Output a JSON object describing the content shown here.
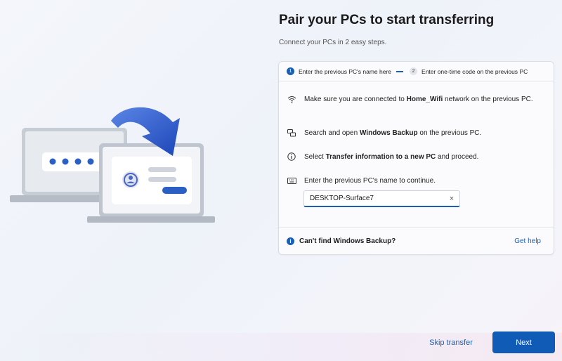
{
  "header": {
    "title": "Pair your PCs to start transferring",
    "subtitle": "Connect your PCs in 2 easy steps."
  },
  "steps": [
    {
      "number": "1",
      "label": "Enter the previous PC's name here",
      "state": "active"
    },
    {
      "number": "2",
      "label": "Enter one-time code on the previous PC",
      "state": "inactive"
    }
  ],
  "instructions": {
    "wifi": {
      "icon": "wifi-icon",
      "pre": "Make sure you are connected to ",
      "bold": "Home_Wifi",
      "post": " network on the previous PC."
    },
    "backup": {
      "icon": "windows-backup-icon",
      "pre": "Search and open ",
      "bold": "Windows Backup",
      "post": " on the previous PC."
    },
    "transfer": {
      "icon": "info-circle-icon",
      "pre": "Select ",
      "bold": "Transfer information to a new PC",
      "post": " and proceed."
    },
    "name": {
      "icon": "keyboard-icon",
      "text": "Enter the previous PC's name to continue."
    }
  },
  "pc_name_field": {
    "value": "DESKTOP-Surface7",
    "clear_icon": "×"
  },
  "help": {
    "label": "Can't find Windows Backup?",
    "link": "Get help",
    "icon": "i"
  },
  "footer": {
    "skip_label": "Skip transfer",
    "next_label": "Next"
  },
  "colors": {
    "accent": "#0f5bb5",
    "link": "#1a5fb4"
  }
}
